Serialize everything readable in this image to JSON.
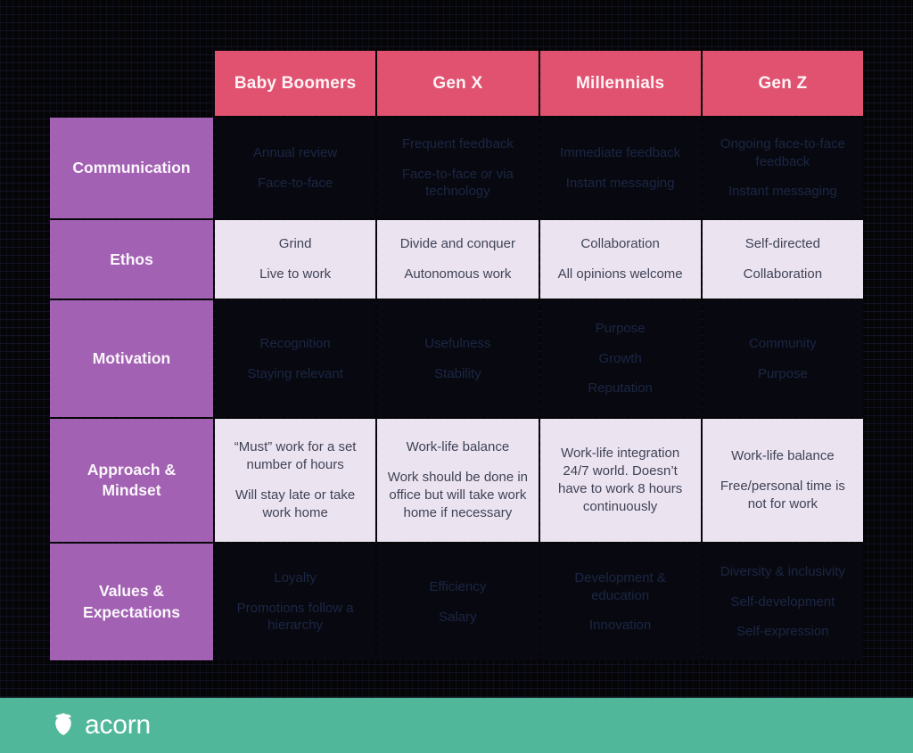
{
  "table": {
    "corner_label": "",
    "column_headers": [
      "Baby Boomers",
      "Gen X",
      "Millennials",
      "Gen Z"
    ],
    "rows": [
      {
        "label": "Communication",
        "style": "dark",
        "cells": [
          [
            "Annual review",
            "Face-to-face"
          ],
          [
            "Frequent feedback",
            "Face-to-face or via technology"
          ],
          [
            "Immediate feedback",
            "Instant messaging"
          ],
          [
            "Ongoing face-to-face feedback",
            "Instant messaging"
          ]
        ]
      },
      {
        "label": "Ethos",
        "style": "light",
        "cells": [
          [
            "Grind",
            "Live to work"
          ],
          [
            "Divide and conquer",
            "Autonomous work"
          ],
          [
            "Collaboration",
            "All opinions welcome"
          ],
          [
            "Self-directed",
            "Collaboration"
          ]
        ]
      },
      {
        "label": "Motivation",
        "style": "dark",
        "cells": [
          [
            "Recognition",
            "Staying relevant"
          ],
          [
            "Usefulness",
            "Stability"
          ],
          [
            "Purpose",
            "Growth",
            "Reputation"
          ],
          [
            "Community",
            "Purpose"
          ]
        ]
      },
      {
        "label": "Approach & Mindset",
        "style": "light",
        "cells": [
          [
            "“Must” work for a set number of hours",
            "Will stay late or take work home"
          ],
          [
            "Work-life balance",
            "Work should be done in office but will take work home if necessary"
          ],
          [
            "Work-life integration 24/7 world. Doesn’t have to work 8 hours continuously"
          ],
          [
            "Work-life balance",
            "Free/personal time is not for work"
          ]
        ]
      },
      {
        "label": "Values & Expectations",
        "style": "dark",
        "cells": [
          [
            "Loyalty",
            "Promotions follow a hierarchy"
          ],
          [
            "Efficiency",
            "Salary"
          ],
          [
            "Development & education",
            "Innovation"
          ],
          [
            "Diversity & inclusivity",
            "Self-development",
            "Self-expression"
          ]
        ]
      }
    ]
  },
  "footer": {
    "brand_name": "acorn",
    "brand_icon": "acorn-icon"
  },
  "colors": {
    "header_pink": "#e05270",
    "row_header_purple": "#a261b2",
    "cell_light_bg": "#ece3f1",
    "cell_light_text": "#3f4355",
    "cell_dark_bg": "#080810",
    "cell_dark_text": "#1b2744",
    "footer_green": "#51b79a",
    "page_bg": "#050507"
  }
}
